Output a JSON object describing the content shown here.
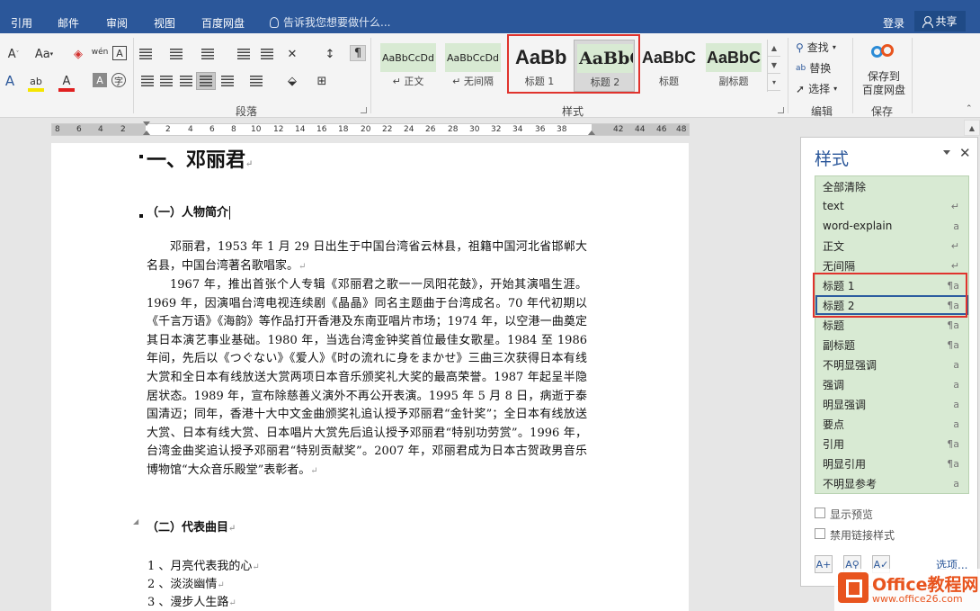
{
  "tabs": [
    "引用",
    "邮件",
    "审阅",
    "视图",
    "百度网盘"
  ],
  "tellme": "告诉我您想要做什么...",
  "account": {
    "login": "登录",
    "share": "共享"
  },
  "ribbon": {
    "font_group": {
      "aa_btn": "Aa",
      "wen_btn": "wén",
      "a_btn": "A"
    },
    "paragraph_label": "段落",
    "styles_label": "样式",
    "editing_label": "编辑",
    "save_label": "保存",
    "gallery": [
      {
        "preview": "AaBbCcDd",
        "name": "↵ 正文"
      },
      {
        "preview": "AaBbCcDd",
        "name": "↵ 无间隔"
      },
      {
        "preview": "AaBb",
        "name": "标题 1"
      },
      {
        "preview": "AaBbC",
        "name": "标题 2"
      },
      {
        "preview": "AaBbC",
        "name": "标题"
      },
      {
        "preview": "AaBbC",
        "name": "副标题"
      }
    ],
    "find": "查找",
    "replace": "替换",
    "select": "选择",
    "save_baidu": [
      "保存到",
      "百度网盘"
    ]
  },
  "ruler_numbers": [
    "8",
    "6",
    "4",
    "2",
    "2",
    "4",
    "6",
    "8",
    "10",
    "12",
    "14",
    "16",
    "18",
    "20",
    "22",
    "24",
    "26",
    "28",
    "30",
    "32",
    "34",
    "36",
    "38",
    "42",
    "44",
    "46",
    "48"
  ],
  "document": {
    "h1": "一、邓丽君",
    "h2a": "（一）人物简介",
    "para1": "邓丽君，1953 年 1 月 29 日出生于中国台湾省云林县，祖籍中国河北省邯郸大名县，中国台湾著名歌唱家。",
    "para2": "1967 年，推出首张个人专辑《邓丽君之歌一一凤阳花鼓》，开始其演唱生涯。1969 年，因演唱台湾电视连续剧《晶晶》同名主题曲于台湾成名。70 年代初期以《千言万语》《海韵》等作品打开香港及东南亚唱片市场；1974 年，以空港一曲奠定其日本演艺事业基础。1980 年，当选台湾金钟奖首位最佳女歌星。1984 至 1986 年间，先后以《つぐない》《爱人》《时の流れに身をまかせ》三曲三次获得日本有线大赏和全日本有线放送大赏两项日本音乐颁奖礼大奖的最高荣誉。1987 年起呈半隐居状态。1989 年，宣布除慈善义演外不再公开表演。1995 年 5 月 8 日，病逝于泰国清迈；同年，香港十大中文金曲颁奖礼追认授予邓丽君“金针奖”；全日本有线放送大赏、日本有线大赏、日本唱片大赏先后追认授予邓丽君“特别功劳赏”。1996 年，台湾金曲奖追认授予邓丽君“特别贡献奖”。2007 年，邓丽君成为日本古贺政男音乐博物馆“大众音乐殿堂”表彰者。",
    "h2b": "（二）代表曲目",
    "list": [
      "1 、月亮代表我的心",
      "2 、淡淡幽情",
      "3 、漫步人生路"
    ]
  },
  "styles_pane": {
    "title": "样式",
    "items": [
      {
        "label": "全部清除",
        "sym": ""
      },
      {
        "label": "text",
        "sym": "↵"
      },
      {
        "label": "word-explain",
        "sym": "a"
      },
      {
        "label": "正文",
        "sym": "↵"
      },
      {
        "label": "无间隔",
        "sym": "↵"
      },
      {
        "label": "标题 1",
        "sym": "¶a"
      },
      {
        "label": "标题 2",
        "sym": "¶a"
      },
      {
        "label": "标题",
        "sym": "¶a"
      },
      {
        "label": "副标题",
        "sym": "¶a"
      },
      {
        "label": "不明显强调",
        "sym": "a"
      },
      {
        "label": "强调",
        "sym": "a"
      },
      {
        "label": "明显强调",
        "sym": "a"
      },
      {
        "label": "要点",
        "sym": "a"
      },
      {
        "label": "引用",
        "sym": "¶a"
      },
      {
        "label": "明显引用",
        "sym": "¶a"
      },
      {
        "label": "不明显参考",
        "sym": "a"
      }
    ],
    "show_preview": "显示预览",
    "disable_linked": "禁用链接样式",
    "options": "选项..."
  },
  "watermark": {
    "brand": "Office教程网",
    "url": "www.office26.com"
  },
  "colors": {
    "accent": "#2b579a",
    "style_bg": "#d8ead3",
    "highlight": "#e0332d"
  }
}
